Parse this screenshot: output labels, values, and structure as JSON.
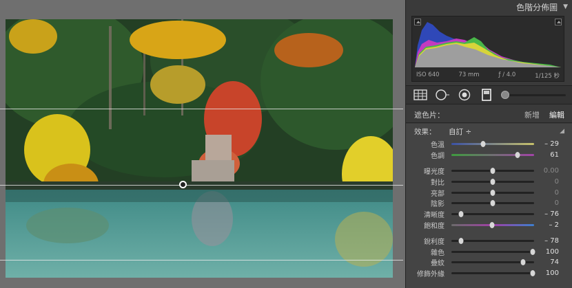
{
  "panel": {
    "histogram_title": "色階分佈圖",
    "collapse_glyph": "▼",
    "iso": "ISO 640",
    "focal": "73 mm",
    "aperture": "ƒ / 4.0",
    "shutter": "1/125 秒"
  },
  "mask": {
    "label": "遮色片：",
    "new_label": "新增",
    "edit_label": "編輯"
  },
  "effect": {
    "label": "效果：",
    "value": "自訂 ÷"
  },
  "sliders_wb": [
    {
      "name": "色溫",
      "value": "– 29",
      "level": 0.38,
      "track": "temp"
    },
    {
      "name": "色調",
      "value": "61",
      "level": 0.8,
      "track": "tint"
    }
  ],
  "sliders_tone": [
    {
      "name": "曝光度",
      "value": "0.00",
      "level": 0.5,
      "dim": true
    },
    {
      "name": "對比",
      "value": "0",
      "level": 0.5,
      "dim": true
    },
    {
      "name": "亮部",
      "value": "0",
      "level": 0.5,
      "dim": true
    },
    {
      "name": "陰影",
      "value": "0",
      "level": 0.5,
      "dim": true
    },
    {
      "name": "清晰度",
      "value": "– 76",
      "level": 0.12,
      "dim": false
    },
    {
      "name": "飽和度",
      "value": "– 2",
      "level": 0.49,
      "dim": false,
      "track": "sat"
    }
  ],
  "sliders_detail": [
    {
      "name": "銳利度",
      "value": "– 78",
      "level": 0.12,
      "dim": false
    },
    {
      "name": "雜色",
      "value": "100",
      "level": 0.98,
      "dim": false
    },
    {
      "name": "疊紋",
      "value": "74",
      "level": 0.87,
      "dim": false
    },
    {
      "name": "修飾外緣",
      "value": "100",
      "level": 0.98,
      "dim": false
    }
  ],
  "colors": {
    "panel_bg": "#3a3a3a",
    "lower_bg": "#444444",
    "canvas_bg": "#6f6f6f"
  }
}
